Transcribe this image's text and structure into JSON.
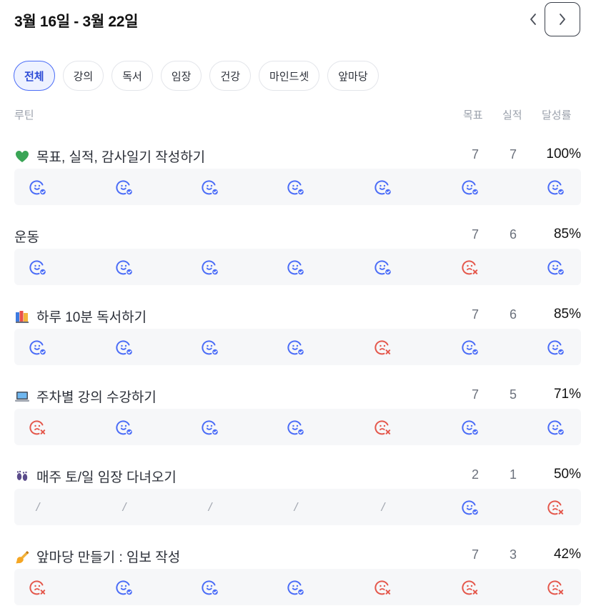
{
  "header": {
    "date_range": "3월 16일 - 3월 22일",
    "prev_icon": "chevron-left-icon",
    "next_icon": "chevron-right-icon"
  },
  "filters": [
    "전체",
    "강의",
    "독서",
    "임장",
    "건강",
    "마인드셋",
    "앞마당"
  ],
  "active_filter": "전체",
  "columns": {
    "routine": "루틴",
    "goal": "목표",
    "actual": "실적",
    "rate": "달성률"
  },
  "colors": {
    "accent": "#4a6cf7",
    "success_icon": "#4a6cf7",
    "fail_icon": "#e4574b",
    "bar_bg": "#f6f7f9"
  },
  "routines": [
    {
      "emoji": "green-heart-icon",
      "title": "목표, 실적, 감사일기 작성하기",
      "goal": "7",
      "actual": "7",
      "rate": "100%",
      "days": [
        "done",
        "done",
        "done",
        "done",
        "done",
        "done",
        "done"
      ]
    },
    {
      "emoji": "",
      "title": "운동",
      "goal": "7",
      "actual": "6",
      "rate": "85%",
      "days": [
        "done",
        "done",
        "done",
        "done",
        "done",
        "fail",
        "done"
      ]
    },
    {
      "emoji": "books-icon",
      "title": "하루 10분 독서하기",
      "goal": "7",
      "actual": "6",
      "rate": "85%",
      "days": [
        "done",
        "done",
        "done",
        "done",
        "fail",
        "done",
        "done"
      ]
    },
    {
      "emoji": "laptop-icon",
      "title": "주차별 강의 수강하기",
      "goal": "7",
      "actual": "5",
      "rate": "71%",
      "days": [
        "fail",
        "done",
        "done",
        "done",
        "fail",
        "done",
        "done"
      ]
    },
    {
      "emoji": "footprints-icon",
      "title": "매주 토/일 임장 다녀오기",
      "goal": "2",
      "actual": "1",
      "rate": "50%",
      "days": [
        "none",
        "none",
        "none",
        "none",
        "none",
        "done",
        "fail"
      ]
    },
    {
      "emoji": "writing-hand-icon",
      "title": "앞마당 만들기 : 임보 작성",
      "goal": "7",
      "actual": "3",
      "rate": "42%",
      "days": [
        "fail",
        "done",
        "done",
        "done",
        "fail",
        "fail",
        "fail"
      ]
    }
  ],
  "none_mark": "/"
}
